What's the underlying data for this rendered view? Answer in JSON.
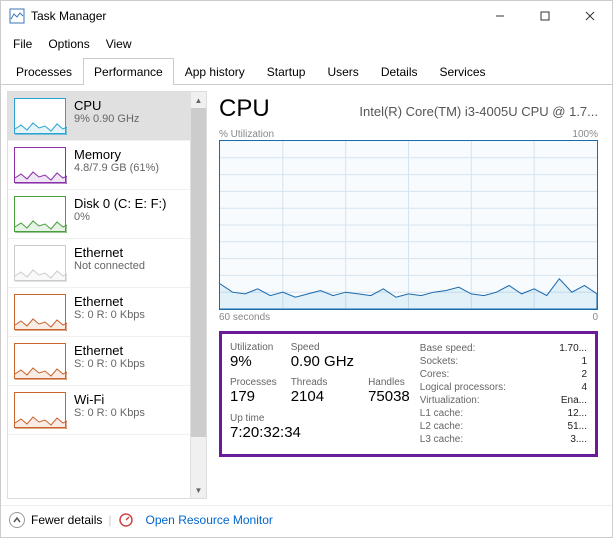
{
  "window": {
    "title": "Task Manager"
  },
  "menu": {
    "file": "File",
    "options": "Options",
    "view": "View"
  },
  "tabs": {
    "processes": "Processes",
    "performance": "Performance",
    "app_history": "App history",
    "startup": "Startup",
    "users": "Users",
    "details": "Details",
    "services": "Services"
  },
  "sidebar": {
    "items": [
      {
        "name": "CPU",
        "sub": "9% 0.90 GHz",
        "color": "#2ca4d2"
      },
      {
        "name": "Memory",
        "sub": "4.8/7.9 GB (61%)",
        "color": "#8a2fa8"
      },
      {
        "name": "Disk 0 (C: E: F:)",
        "sub": "0%",
        "color": "#4a9e3e"
      },
      {
        "name": "Ethernet",
        "sub": "Not connected",
        "color": "#cccccc"
      },
      {
        "name": "Ethernet",
        "sub": "S: 0  R: 0 Kbps",
        "color": "#c8642e"
      },
      {
        "name": "Ethernet",
        "sub": "S: 0  R: 0 Kbps",
        "color": "#c8642e"
      },
      {
        "name": "Wi-Fi",
        "sub": "S: 0  R: 0 Kbps",
        "color": "#c8642e"
      }
    ]
  },
  "cpu": {
    "title": "CPU",
    "model": "Intel(R) Core(TM) i3-4005U CPU @ 1.7...",
    "chart_top_left": "% Utilization",
    "chart_top_right": "100%",
    "chart_bottom_left": "60 seconds",
    "chart_bottom_right": "0",
    "labels": {
      "utilization": "Utilization",
      "speed": "Speed",
      "processes": "Processes",
      "threads": "Threads",
      "handles": "Handles",
      "uptime": "Up time",
      "base_speed": "Base speed:",
      "sockets": "Sockets:",
      "cores": "Cores:",
      "logical": "Logical processors:",
      "virtualization": "Virtualization:",
      "l1": "L1 cache:",
      "l2": "L2 cache:",
      "l3": "L3 cache:"
    },
    "values": {
      "utilization": "9%",
      "speed": "0.90 GHz",
      "processes": "179",
      "threads": "2104",
      "handles": "75038",
      "uptime": "7:20:32:34",
      "base_speed": "1.70...",
      "sockets": "1",
      "cores": "2",
      "logical": "4",
      "virtualization": "Ena...",
      "l1": "12...",
      "l2": "51...",
      "l3": "3...."
    }
  },
  "footer": {
    "fewer": "Fewer details",
    "resmon": "Open Resource Monitor"
  },
  "chart_data": {
    "type": "line",
    "title": "% Utilization",
    "xlabel": "60 seconds",
    "ylabel": "",
    "ylim": [
      0,
      100
    ],
    "x": [
      0,
      2,
      4,
      6,
      8,
      10,
      12,
      14,
      16,
      18,
      20,
      22,
      24,
      26,
      28,
      30,
      32,
      34,
      36,
      38,
      40,
      42,
      44,
      46,
      48,
      50,
      52,
      54,
      56,
      58,
      60
    ],
    "values": [
      15,
      10,
      9,
      12,
      8,
      10,
      7,
      9,
      11,
      8,
      10,
      9,
      8,
      12,
      7,
      9,
      8,
      10,
      11,
      13,
      9,
      8,
      10,
      14,
      9,
      12,
      8,
      18,
      10,
      14,
      9
    ]
  }
}
